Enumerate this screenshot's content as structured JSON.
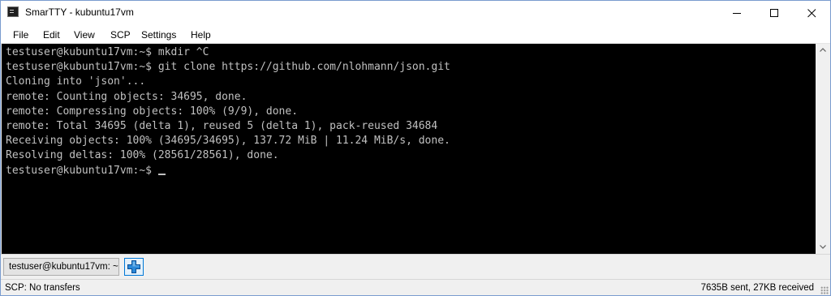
{
  "window": {
    "title": "SmarTTY - kubuntu17vm"
  },
  "menu": {
    "file": "File",
    "edit": "Edit",
    "view": "View",
    "scp": "SCP",
    "settings": "Settings",
    "help": "Help"
  },
  "terminal": {
    "lines": [
      "testuser@kubuntu17vm:~$ mkdir ^C",
      "testuser@kubuntu17vm:~$ git clone https://github.com/nlohmann/json.git",
      "Cloning into 'json'...",
      "remote: Counting objects: 34695, done.",
      "remote: Compressing objects: 100% (9/9), done.",
      "remote: Total 34695 (delta 1), reused 5 (delta 1), pack-reused 34684",
      "Receiving objects: 100% (34695/34695), 137.72 MiB | 11.24 MiB/s, done.",
      "Resolving deltas: 100% (28561/28561), done.",
      "testuser@kubuntu17vm:~$"
    ],
    "background_color": "#000000",
    "text_color": "#c0c0c0"
  },
  "tabs": {
    "active_tab_label": "testuser@kubuntu17vm: ~",
    "add_tab_icon": "plus-icon"
  },
  "status": {
    "left": "SCP: No transfers",
    "right": "7635B sent, 27KB received"
  },
  "icons": {
    "app": "terminal-icon",
    "minimize": "minimize-icon",
    "maximize": "maximize-icon",
    "close": "close-icon"
  },
  "colors": {
    "accent": "#0078d7",
    "add_tab_fill": "#2b88d8"
  }
}
